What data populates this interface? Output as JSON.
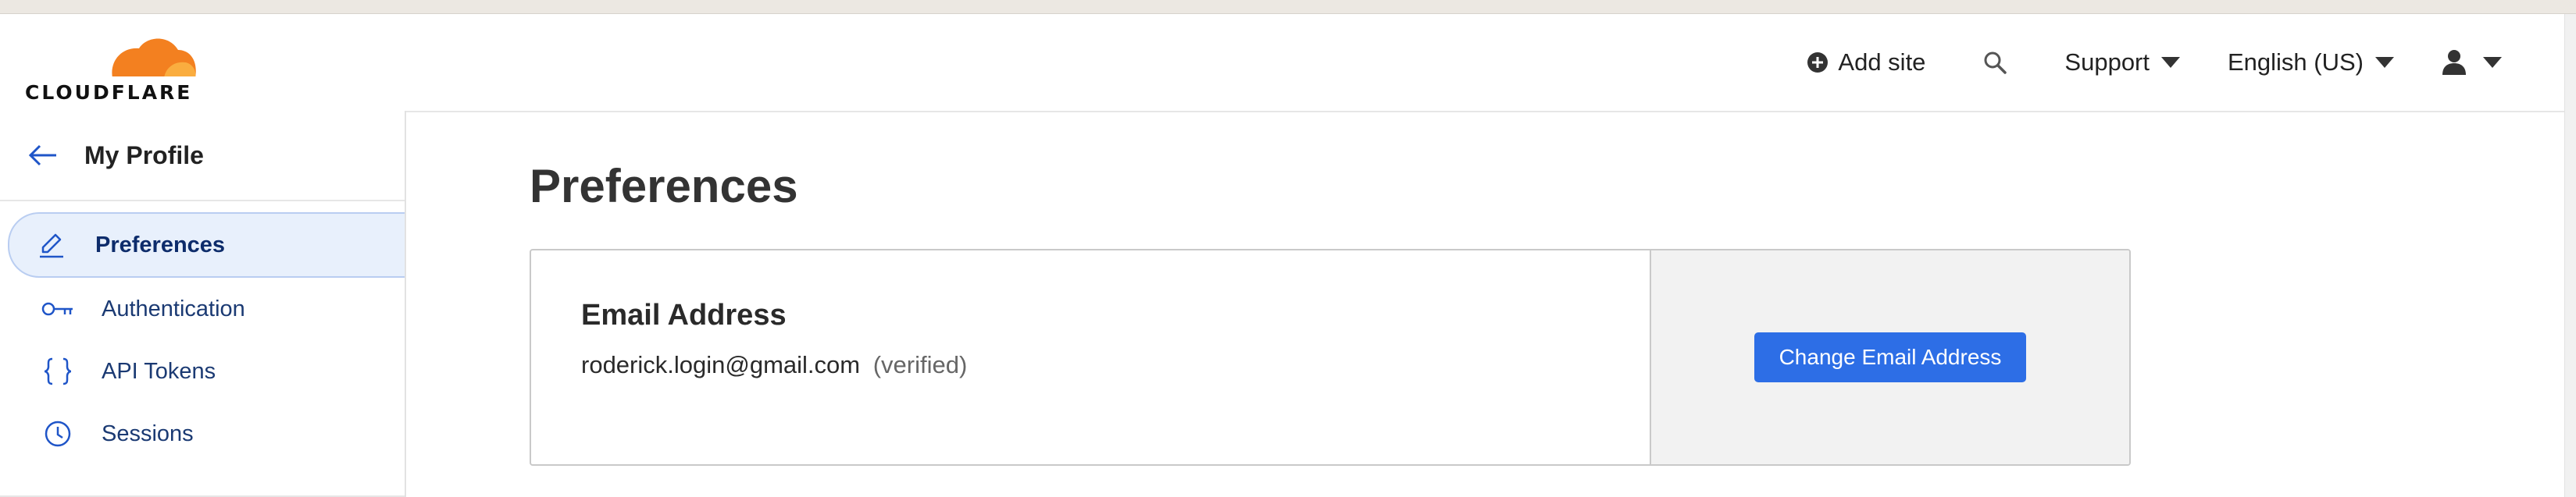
{
  "brand": {
    "logo_text": "CLOUDFLARE",
    "cloud_color": "#f38020",
    "cloud_color_light": "#faad3f"
  },
  "topnav": {
    "add_site_label": "Add site",
    "support_label": "Support",
    "language_label": "English (US)",
    "icons": [
      "plus-circle-icon",
      "search-icon",
      "caret-down-icon",
      "user-icon"
    ]
  },
  "sidebar": {
    "title": "My Profile",
    "items": [
      {
        "label": "Preferences",
        "icon": "pencil-icon",
        "active": true
      },
      {
        "label": "Authentication",
        "icon": "key-icon",
        "active": false
      },
      {
        "label": "API Tokens",
        "icon": "curly-braces-icon",
        "active": false
      },
      {
        "label": "Sessions",
        "icon": "clock-icon",
        "active": false
      }
    ]
  },
  "main": {
    "page_title": "Preferences",
    "email_card": {
      "heading": "Email Address",
      "email": "roderick.login@gmail.com",
      "status": "(verified)",
      "button_label": "Change Email Address"
    }
  },
  "colors": {
    "accent": "#2d6ee6",
    "active_bg": "#e8f0fc",
    "nav_text": "#1b3a73"
  }
}
